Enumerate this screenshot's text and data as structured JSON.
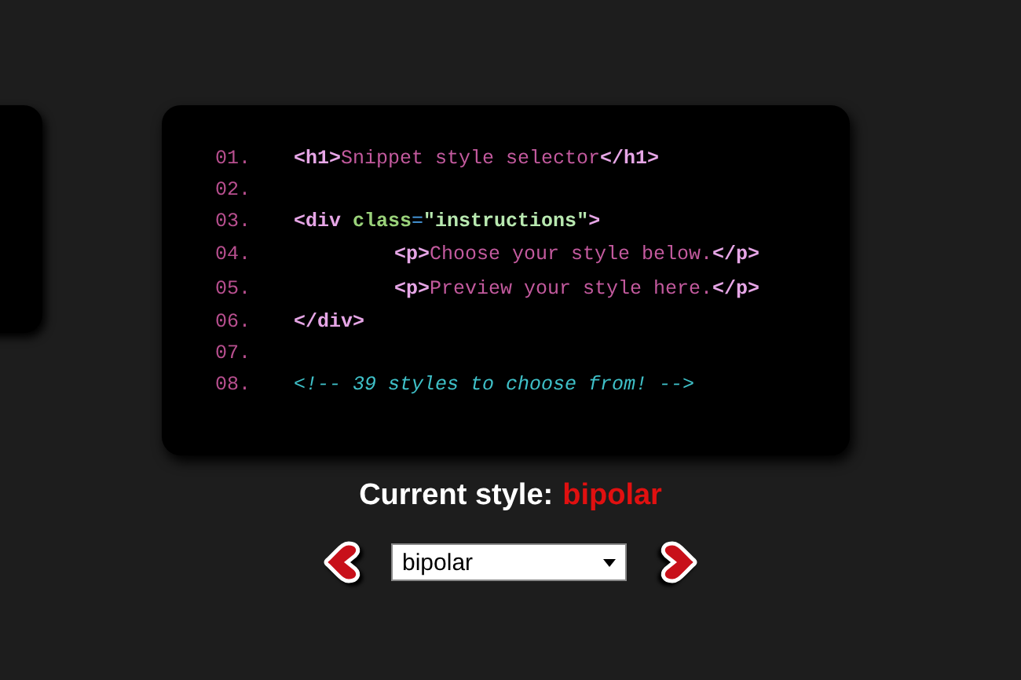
{
  "code_lines": [
    {
      "number": "01.",
      "tokens": [
        {
          "kind": "tag",
          "text": "<h1>"
        },
        {
          "kind": "text",
          "text": "Snippet style selector"
        },
        {
          "kind": "tag",
          "text": "</h1>"
        }
      ]
    },
    {
      "number": "02."
    },
    {
      "number": "03.",
      "tokens": [
        {
          "kind": "tag",
          "text": "<div "
        },
        {
          "kind": "attr",
          "text": "class"
        },
        {
          "kind": "punct",
          "text": "="
        },
        {
          "kind": "string",
          "text": "\"instructions\""
        },
        {
          "kind": "tag",
          "text": ">"
        }
      ],
      "children": [
        {
          "number": "04.",
          "tokens": [
            {
              "kind": "tag",
              "text": "<p>"
            },
            {
              "kind": "text",
              "text": "Choose your style below."
            },
            {
              "kind": "tag",
              "text": "</p>"
            }
          ]
        },
        {
          "number": "05.",
          "tokens": [
            {
              "kind": "tag",
              "text": "<p>"
            },
            {
              "kind": "text",
              "text": "Preview your style here."
            },
            {
              "kind": "tag",
              "text": "</p>"
            }
          ]
        }
      ]
    },
    {
      "number": "06.",
      "tokens": [
        {
          "kind": "tag",
          "text": "</div>"
        }
      ]
    },
    {
      "number": "07."
    },
    {
      "number": "08.",
      "tokens": [
        {
          "kind": "comment",
          "text": "<!-- 39 styles to choose from! -->"
        }
      ]
    }
  ],
  "current_style": {
    "label": "Current style:",
    "value": "bipolar"
  },
  "style_select": {
    "value": "bipolar"
  }
}
